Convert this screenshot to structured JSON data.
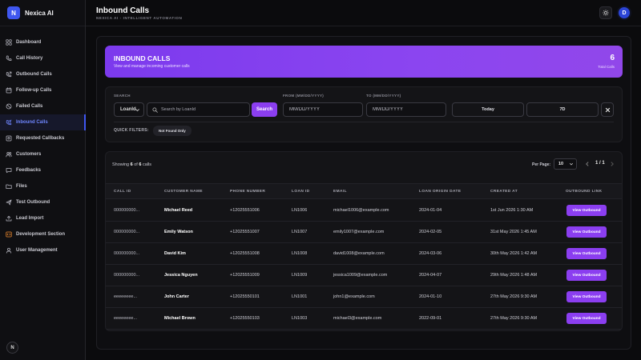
{
  "brand": {
    "logo_letter": "N",
    "name": "Nexica AI"
  },
  "sidebar": {
    "items": [
      {
        "label": "Dashboard",
        "icon": "grid-icon",
        "active": false
      },
      {
        "label": "Call History",
        "icon": "phone-icon",
        "active": false
      },
      {
        "label": "Outbound Calls",
        "icon": "phone-outgoing-icon",
        "active": false
      },
      {
        "label": "Follow-up Calls",
        "icon": "calendar-icon",
        "active": false
      },
      {
        "label": "Failed Calls",
        "icon": "ban-icon",
        "active": false
      },
      {
        "label": "Inbound Calls",
        "icon": "phone-incoming-icon",
        "active": true
      },
      {
        "label": "Requested Callbacks",
        "icon": "callback-icon",
        "active": false
      },
      {
        "label": "Customers",
        "icon": "users-icon",
        "active": false
      },
      {
        "label": "Feedbacks",
        "icon": "message-icon",
        "active": false
      },
      {
        "label": "Files",
        "icon": "folder-icon",
        "active": false
      },
      {
        "label": "Test Outbound",
        "icon": "send-icon",
        "active": false
      },
      {
        "label": "Lead Import",
        "icon": "upload-icon",
        "active": false
      },
      {
        "label": "Development Section",
        "icon": "code-icon",
        "active": false
      },
      {
        "label": "User Management",
        "icon": "user-icon",
        "active": false
      }
    ],
    "footer_letter": "N"
  },
  "header": {
    "title": "Inbound Calls",
    "subtitle": "NEXICA AI - INTELLIGENT AUTOMATION",
    "avatar_letter": "D"
  },
  "banner": {
    "title": "INBOUND CALLS",
    "subtitle": "View and manage incoming customer calls",
    "count": "6",
    "count_label": "Total Calls"
  },
  "filters": {
    "search_label": "SEARCH",
    "field_select": "LoanId",
    "search_placeholder": "Search by LoanId",
    "search_button": "Search",
    "from_label": "FROM (MM/DD/YYYY)",
    "from_placeholder": "MM/DD/YYYY",
    "to_label": "TO (MM/DD/YYYY)",
    "to_placeholder": "MM/DD/YYYY",
    "today_button": "Today",
    "seven_day_button": "7D",
    "quick_filters_label": "QUICK FILTERS:",
    "quick_chip": "Not Found Only"
  },
  "table_controls": {
    "showing_prefix": "Showing ",
    "shown": "6",
    "of_text": " of ",
    "total": "6",
    "suffix": " calls",
    "per_page_label": "Per Page:",
    "per_page_value": "10",
    "page_text": "1 / 1"
  },
  "table": {
    "columns": [
      "CALL ID",
      "CUSTOMER NAME",
      "PHONE NUMBER",
      "LOAN ID",
      "EMAIL",
      "LOAN ORIGIN DATE",
      "CREATED AT",
      "OUTBOUND LINK"
    ],
    "rows": [
      {
        "call_id": "000000000...",
        "name": "Michael Reed",
        "phone": "+12025551006",
        "loan_id": "LN1006",
        "email": "michael1006@example.com",
        "origin": "2024-01-04",
        "created": "1st Jun 2026 1:30 AM",
        "action": "View Outbound"
      },
      {
        "call_id": "000000000...",
        "name": "Emily Watson",
        "phone": "+12025551007",
        "loan_id": "LN1007",
        "email": "emily1007@example.com",
        "origin": "2024-02-05",
        "created": "31st May 2026 1:45 AM",
        "action": "View Outbound"
      },
      {
        "call_id": "000000000...",
        "name": "David Kim",
        "phone": "+12025551008",
        "loan_id": "LN1008",
        "email": "david1008@example.com",
        "origin": "2024-03-06",
        "created": "30th May 2026 1:42 AM",
        "action": "View Outbound"
      },
      {
        "call_id": "000000000...",
        "name": "Jessica Nguyen",
        "phone": "+12025551009",
        "loan_id": "LN1009",
        "email": "jessica1009@example.com",
        "origin": "2024-04-07",
        "created": "29th May 2026 1:48 AM",
        "action": "View Outbound"
      },
      {
        "call_id": "eeeeeeee...",
        "name": "John Carter",
        "phone": "+12025550101",
        "loan_id": "LN1001",
        "email": "john1@example.com",
        "origin": "2024-01-10",
        "created": "27th May 2026 9:30 AM",
        "action": "View Outbound"
      },
      {
        "call_id": "eeeeeeee...",
        "name": "Michael Brown",
        "phone": "+12025550103",
        "loan_id": "LN1003",
        "email": "michael3@example.com",
        "origin": "2022-09-01",
        "created": "27th May 2026 9:30 AM",
        "action": "View Outbound"
      }
    ]
  },
  "colors": {
    "accent": "#8b3ef0",
    "brand_blue": "#3f57f0",
    "active_nav": "#6f86ff"
  }
}
